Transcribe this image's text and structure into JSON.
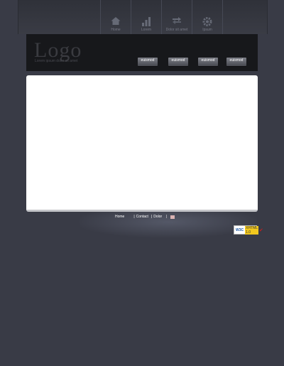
{
  "nav": {
    "items": [
      {
        "label": "Home",
        "icon": "home-icon"
      },
      {
        "label": "Lorem",
        "icon": "bar-chart-icon"
      },
      {
        "label": "Dolor sit amet",
        "icon": "transfer-icon"
      },
      {
        "label": "Ipsum",
        "icon": "gear-icon"
      }
    ]
  },
  "header": {
    "logo": "Logo",
    "tagline": "Lorem ipsum dolor sit amet",
    "buttons": [
      "euismod",
      "euismod",
      "euismod",
      "euismod"
    ]
  },
  "footer": {
    "links": [
      "Home",
      "Contact",
      "Dolor"
    ],
    "separator": "|",
    "badge": {
      "left": "W3C",
      "right": "XHTML 1.0"
    }
  },
  "colors": {
    "background": "#393b46",
    "header": "#17181b",
    "content": "#ffffff"
  }
}
